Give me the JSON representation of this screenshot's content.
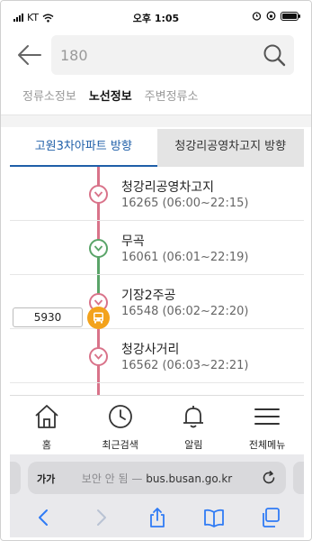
{
  "status_bar": {
    "carrier": "KT",
    "time": "오후 1:05"
  },
  "search": {
    "query": "180"
  },
  "sub_tabs": [
    {
      "label": "정류소정보",
      "active": false
    },
    {
      "label": "노선정보",
      "active": true
    },
    {
      "label": "주변정류소",
      "active": false
    }
  ],
  "direction_tabs": [
    {
      "label": "고원3차아파트 방향",
      "active": true
    },
    {
      "label": "청강리공영차고지 방향",
      "active": false
    }
  ],
  "stops": [
    {
      "name": "청강리공영차고지",
      "info": "16265 (06:00~22:15)",
      "dot_color": "#d9738a"
    },
    {
      "name": "무곡",
      "info": "16061 (06:01~22:19)",
      "dot_color": "#5aa469"
    },
    {
      "name": "기장2주공",
      "info": "16548 (06:02~22:20)",
      "dot_color": "#d9738a"
    },
    {
      "name": "청강사거리",
      "info": "16562 (06:03~22:21)",
      "dot_color": "#d9738a"
    }
  ],
  "bus_marker": {
    "plate": "5930"
  },
  "bottom_nav": [
    {
      "label": "홈",
      "icon": "home-icon"
    },
    {
      "label": "최근검색",
      "icon": "clock-icon"
    },
    {
      "label": "알림",
      "icon": "bell-icon"
    },
    {
      "label": "전체메뉴",
      "icon": "menu-icon"
    }
  ],
  "browser": {
    "text_size_label": "가가",
    "security_label": "보안 안 됨 —",
    "domain": "bus.busan.go.kr"
  },
  "colors": {
    "accent_blue": "#1f5fa8",
    "route_red": "#d9738a",
    "route_green": "#5aa469",
    "bus_orange": "#f3a21b"
  }
}
